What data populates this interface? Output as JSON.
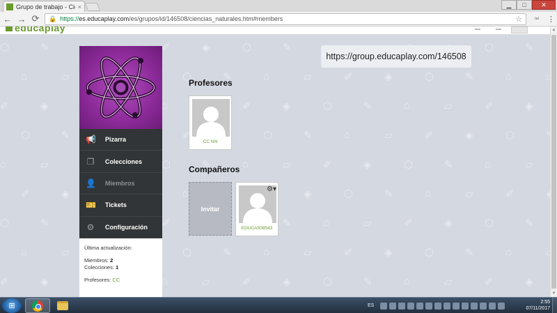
{
  "browser": {
    "tab_title": "Grupo de trabajo - Cien",
    "tab_close": "×",
    "window_controls": {
      "minimize": "▁",
      "maximize": "□",
      "close": "✕"
    },
    "nav": {
      "back": "←",
      "forward": "→",
      "reload": "⟳"
    },
    "address": {
      "lock": "🔒",
      "scheme": "https://",
      "host": "es.educaplay.com",
      "path": "/es/grupos/id/146508/ciencias_naturales.htm#members",
      "star": "☆"
    },
    "extension_label": "⁽ᵃ⁾",
    "menu_icon": "⋮"
  },
  "site": {
    "logo_text": "educaplay"
  },
  "group": {
    "url": "https://group.educaplay.com/146508"
  },
  "sidebar": {
    "menu": [
      {
        "label": "Pizarra",
        "icon": "megaphone-icon",
        "glyph": "📢",
        "active": false
      },
      {
        "label": "Colecciones",
        "icon": "collections-icon",
        "glyph": "❐",
        "active": false
      },
      {
        "label": "Miembros",
        "icon": "members-icon",
        "glyph": "👤",
        "active": true
      },
      {
        "label": "Tickets",
        "icon": "ticket-icon",
        "glyph": "🎫",
        "active": false
      },
      {
        "label": "Configuración",
        "icon": "gear-icon",
        "glyph": "⚙",
        "active": false
      }
    ],
    "info": {
      "last_update_label": "Última actualización:",
      "members_label": "Miembros:",
      "members_count": "2",
      "collections_label": "Colecciones:",
      "collections_count": "1",
      "teachers_label": "Profesores:",
      "teachers_value": "CC"
    }
  },
  "teachers": {
    "title": "Profesores",
    "members": [
      {
        "name": "CC NN"
      }
    ]
  },
  "classmates": {
    "title": "Compañeros",
    "invite_label": "Invitar",
    "members": [
      {
        "name": "EDUCA508543",
        "gear": "⚙▾"
      }
    ]
  },
  "taskbar": {
    "language": "ES",
    "time": "2:55",
    "date": "07/11/2017"
  },
  "colors": {
    "brand_green": "#6a9a2e",
    "menu_dark": "#323537",
    "group_purple": "#8e2c9b"
  }
}
